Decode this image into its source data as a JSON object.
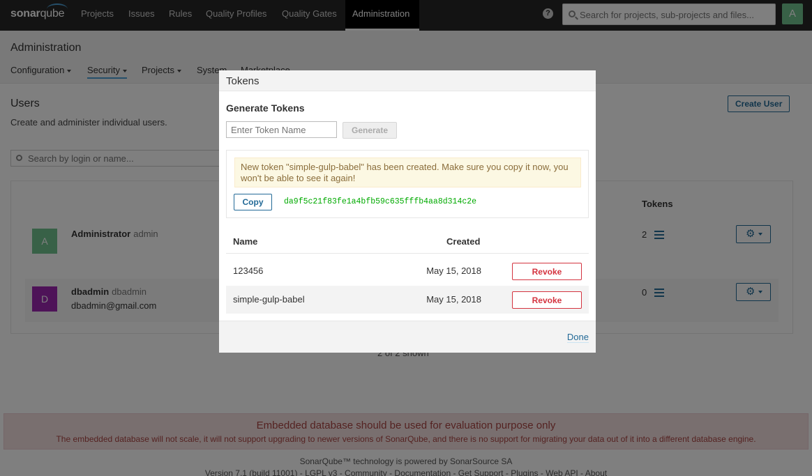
{
  "topnav": {
    "logo_a": "sonar",
    "logo_b": "qube",
    "items": [
      {
        "label": "Projects"
      },
      {
        "label": "Issues"
      },
      {
        "label": "Rules"
      },
      {
        "label": "Quality Profiles"
      },
      {
        "label": "Quality Gates"
      },
      {
        "label": "Administration"
      }
    ],
    "help": "?",
    "search_placeholder": "Search for projects, sub-projects and files...",
    "avatar": "A"
  },
  "header": {
    "title": "Administration",
    "tabs": [
      {
        "label": "Configuration"
      },
      {
        "label": "Security"
      },
      {
        "label": "Projects"
      },
      {
        "label": "System"
      },
      {
        "label": "Marketplace"
      }
    ]
  },
  "users": {
    "title": "Users",
    "description": "Create and administer individual users.",
    "create_label": "Create User",
    "search_placeholder": "Search by login or name...",
    "col_tokens": "Tokens",
    "rows": [
      {
        "avatar": "A",
        "avatar_color": "#71c28f",
        "name": "Administrator",
        "login": "admin",
        "email": "",
        "tokens": "2"
      },
      {
        "avatar": "D",
        "avatar_color": "#9c27b0",
        "name": "dbadmin",
        "login": "dbadmin",
        "email": "dbadmin@gmail.com",
        "tokens": "0"
      }
    ],
    "shown": "2 of 2 shown"
  },
  "warning": {
    "title": "Embedded database should be used for evaluation purpose only",
    "text": "The embedded database will not scale, it will not support upgrading to newer versions of SonarQube, and there is no support for migrating your data out of it into a different database engine."
  },
  "footer": {
    "line1": "SonarQube™ technology is powered by SonarSource SA",
    "version": "Version 7.1 (build 11001)",
    "links": [
      "LGPL v3",
      "Community",
      "Documentation",
      "Get Support",
      "Plugins",
      "Web API",
      "About"
    ],
    "separator": " - "
  },
  "modal": {
    "title": "Tokens",
    "generate_title": "Generate Tokens",
    "input_placeholder": "Enter Token Name",
    "generate_label": "Generate",
    "alert": "New token \"simple-gulp-babel\" has been created. Make sure you copy it now, you won't be able to see it again!",
    "copy_label": "Copy",
    "token_value": "da9f5c21f83fe1a4bfb59c635fffb4aa8d314c2e",
    "col_name": "Name",
    "col_created": "Created",
    "tokens": [
      {
        "name": "123456",
        "created": "May 15, 2018",
        "action": "Revoke"
      },
      {
        "name": "simple-gulp-babel",
        "created": "May 15, 2018",
        "action": "Revoke"
      }
    ],
    "done_label": "Done"
  },
  "colors": {
    "topbar": "#262626",
    "link": "#236a97",
    "danger": "#d4333f",
    "token": "#00aa00"
  }
}
